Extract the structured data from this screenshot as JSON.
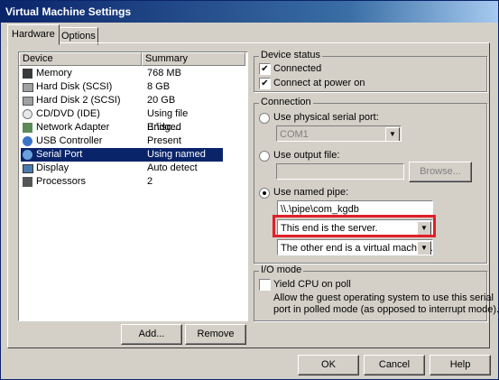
{
  "window": {
    "title": "Virtual Machine Settings"
  },
  "tabs": [
    {
      "label": "Hardware"
    },
    {
      "label": "Options"
    }
  ],
  "device_list": {
    "headers": {
      "device": "Device",
      "summary": "Summary"
    },
    "rows": [
      {
        "device": "Memory",
        "summary": "768 MB",
        "icon": "memory-icon"
      },
      {
        "device": "Hard Disk (SCSI)",
        "summary": "8 GB",
        "icon": "hard-disk-icon"
      },
      {
        "device": "Hard Disk 2 (SCSI)",
        "summary": "20 GB",
        "icon": "hard-disk-icon"
      },
      {
        "device": "CD/DVD (IDE)",
        "summary": "Using file E:\\iso...",
        "icon": "cd-dvd-icon"
      },
      {
        "device": "Network Adapter",
        "summary": "Bridged",
        "icon": "network-adapter-icon"
      },
      {
        "device": "USB Controller",
        "summary": "Present",
        "icon": "usb-icon"
      },
      {
        "device": "Serial Port",
        "summary": "Using named pi...",
        "icon": "serial-port-icon",
        "selected": true
      },
      {
        "device": "Display",
        "summary": "Auto detect",
        "icon": "display-icon"
      },
      {
        "device": "Processors",
        "summary": "2",
        "icon": "processor-icon"
      }
    ]
  },
  "buttons": {
    "add": "Add...",
    "remove": "Remove",
    "ok": "OK",
    "cancel": "Cancel",
    "help": "Help",
    "browse": "Browse..."
  },
  "device_status": {
    "title": "Device status",
    "connected": "Connected",
    "connect_at_power_on": "Connect at power on"
  },
  "connection": {
    "title": "Connection",
    "physical_label": "Use physical serial port:",
    "physical_value": "COM1",
    "output_file_label": "Use output file:",
    "output_file_value": "",
    "named_pipe_label": "Use named pipe:",
    "pipe_name": "\\\\.\\pipe\\com_kgdb",
    "this_end": "This end is the server.",
    "other_end": "The other end is a virtual machine."
  },
  "io_mode": {
    "title": "I/O mode",
    "yield_label": "Yield CPU on poll",
    "description_line1": "Allow the guest operating system to use this serial",
    "description_line2": "port in polled mode (as opposed to interrupt mode)."
  },
  "colors": {
    "highlight_box": "#e0202a",
    "title_bar": "#0a246a",
    "selection": "#0a246a"
  }
}
